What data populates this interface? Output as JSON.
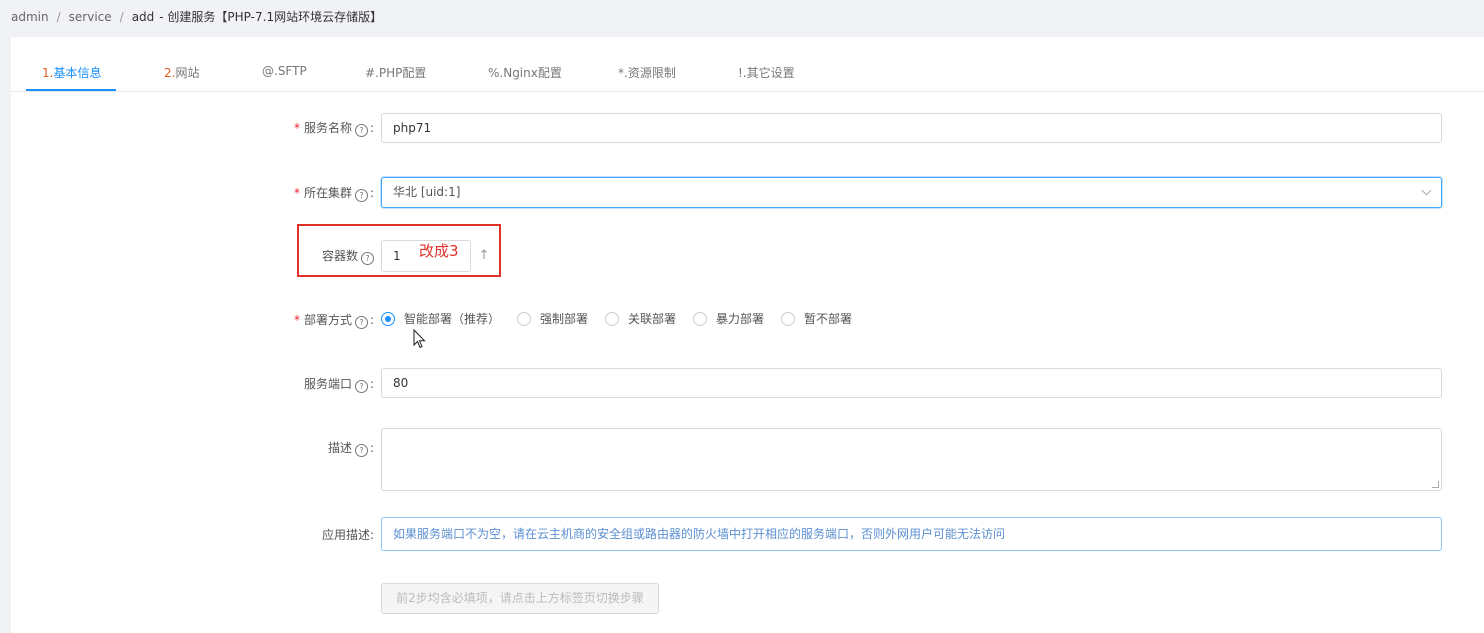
{
  "breadcrumb": {
    "items": [
      "admin",
      "service",
      "add"
    ],
    "separator": "/",
    "title": "-  创建服务【PHP-7.1网站环境云存储版】"
  },
  "tabs": [
    {
      "num": "1.",
      "label": "基本信息",
      "active": true
    },
    {
      "num": "2.",
      "label": "网站"
    },
    {
      "num": "",
      "label": "@.SFTP"
    },
    {
      "num": "",
      "label": "#.PHP配置"
    },
    {
      "num": "",
      "label": "%.Nginx配置"
    },
    {
      "num": "",
      "label": "*.资源限制"
    },
    {
      "num": "",
      "label": "!.其它设置"
    }
  ],
  "form": {
    "service_name": {
      "label": "服务名称",
      "required": true,
      "value": "php71"
    },
    "cluster": {
      "label": "所在集群",
      "required": true,
      "value": "华北 [uid:1]"
    },
    "containers": {
      "label": "容器数",
      "value": "1",
      "annotation": "改成3"
    },
    "deploy": {
      "label": "部署方式",
      "required": true,
      "options": [
        "智能部署（推荐）",
        "强制部署",
        "关联部署",
        "暴力部署",
        "暂不部署"
      ],
      "selected": "智能部署（推荐）"
    },
    "port": {
      "label": "服务端口",
      "value": "80"
    },
    "description": {
      "label": "描述",
      "value": ""
    },
    "app_desc": {
      "label": "应用描述:",
      "text": "如果服务端口不为空，请在云主机商的安全组或路由器的防火墙中打开相应的服务端口，否则外网用户可能无法访问"
    },
    "submit": {
      "label": "前2步均含必填项，请点击上方标签页切换步骤"
    }
  },
  "colors": {
    "accent": "#1890ff",
    "required": "#f5222d",
    "annotation": "#e0322b"
  }
}
